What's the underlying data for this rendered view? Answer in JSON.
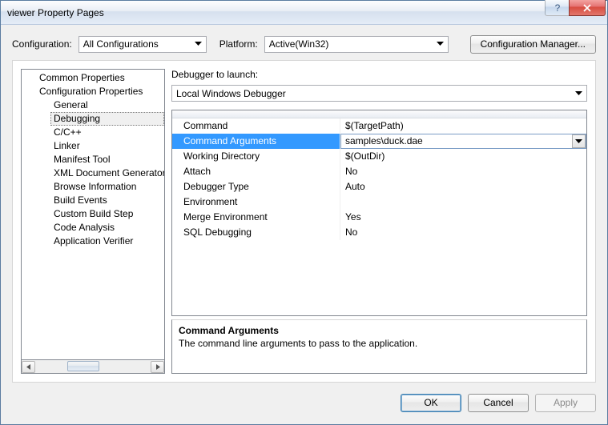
{
  "window": {
    "title": "viewer Property Pages"
  },
  "config_row": {
    "configuration_label": "Configuration:",
    "configuration_value": "All Configurations",
    "platform_label": "Platform:",
    "platform_value": "Active(Win32)",
    "config_manager_btn": "Configuration Manager..."
  },
  "tree": {
    "items": [
      {
        "label": "Common Properties",
        "level": 1,
        "selected": false
      },
      {
        "label": "Configuration Properties",
        "level": 1,
        "selected": false
      },
      {
        "label": "General",
        "level": 2,
        "selected": false
      },
      {
        "label": "Debugging",
        "level": 2,
        "selected": true
      },
      {
        "label": "C/C++",
        "level": 2,
        "selected": false
      },
      {
        "label": "Linker",
        "level": 2,
        "selected": false
      },
      {
        "label": "Manifest Tool",
        "level": 2,
        "selected": false
      },
      {
        "label": "XML Document Generator",
        "level": 2,
        "selected": false
      },
      {
        "label": "Browse Information",
        "level": 2,
        "selected": false
      },
      {
        "label": "Build Events",
        "level": 2,
        "selected": false
      },
      {
        "label": "Custom Build Step",
        "level": 2,
        "selected": false
      },
      {
        "label": "Code Analysis",
        "level": 2,
        "selected": false
      },
      {
        "label": "Application Verifier",
        "level": 2,
        "selected": false
      }
    ]
  },
  "right": {
    "debugger_label": "Debugger to launch:",
    "debugger_value": "Local Windows Debugger",
    "grid": [
      {
        "name": "Command",
        "value": "$(TargetPath)",
        "selected": false
      },
      {
        "name": "Command Arguments",
        "value": "samples\\duck.dae",
        "selected": true
      },
      {
        "name": "Working Directory",
        "value": "$(OutDir)",
        "selected": false
      },
      {
        "name": "Attach",
        "value": "No",
        "selected": false
      },
      {
        "name": "Debugger Type",
        "value": "Auto",
        "selected": false
      },
      {
        "name": "Environment",
        "value": "",
        "selected": false
      },
      {
        "name": "Merge Environment",
        "value": "Yes",
        "selected": false
      },
      {
        "name": "SQL Debugging",
        "value": "No",
        "selected": false
      }
    ],
    "desc": {
      "title": "Command Arguments",
      "text": "The command line arguments to pass to the application."
    }
  },
  "footer": {
    "ok": "OK",
    "cancel": "Cancel",
    "apply": "Apply"
  }
}
